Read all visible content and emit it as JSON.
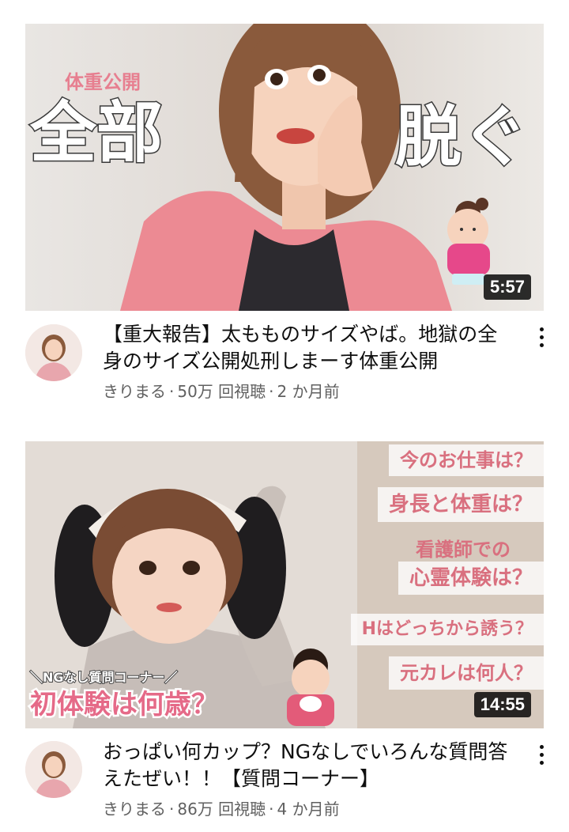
{
  "videos": [
    {
      "duration": "5:57",
      "title": "【重大報告】太もものサイズやば。地獄の全身のサイズ公開処刑しまーす体重公開",
      "channel": "きりまる",
      "views": "50万 回視聴",
      "age": "2 か月前",
      "thumb_text": {
        "small": "体重公開",
        "left_big": "全部",
        "right_big": "脱ぐ"
      }
    },
    {
      "duration": "14:55",
      "title": "おっぱい何カップ？NGなしでいろんな質問答えたぜい！！【質問コーナー】",
      "channel": "きりまる",
      "views": "86万 回視聴",
      "age": "4 か月前",
      "thumb_text": {
        "pills": [
          "今のお仕事は？",
          "身長と体重は？",
          "看護師での",
          "心霊体験は？",
          "Hはどっちから誘う？",
          "元カレは何人？"
        ],
        "corner_label": "＼NGなし質問コーナー／",
        "bottom_big": "初体験は何歳？"
      }
    }
  ],
  "separator": "·"
}
